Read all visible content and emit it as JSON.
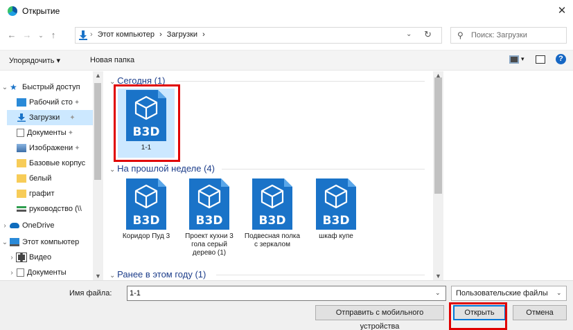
{
  "window": {
    "title": "Открытие",
    "close": "✕"
  },
  "address": {
    "crumbs": [
      "Этот компьютер",
      "›",
      "Загрузки",
      "›"
    ],
    "search_placeholder": "Поиск: Загрузки"
  },
  "toolbar": {
    "organize": "Упорядочить ▾",
    "new_folder": "Новая папка",
    "help": "?"
  },
  "nav": {
    "items": [
      {
        "label": "Быстрый доступ",
        "pinned": false
      },
      {
        "label": "Рабочий сто",
        "pinned": true
      },
      {
        "label": "Загрузки",
        "pinned": true
      },
      {
        "label": "Документы",
        "pinned": true
      },
      {
        "label": "Изображени",
        "pinned": true
      },
      {
        "label": "Базовые корпус",
        "pinned": false
      },
      {
        "label": "белый",
        "pinned": false
      },
      {
        "label": "графит",
        "pinned": false
      },
      {
        "label": "руководство (\\\\",
        "pinned": false
      },
      {
        "label": "OneDrive",
        "pinned": false
      },
      {
        "label": "Этот компьютер",
        "pinned": false
      },
      {
        "label": "Видео",
        "pinned": false
      },
      {
        "label": "Документы",
        "pinned": false
      }
    ]
  },
  "groups": [
    {
      "header": "Сегодня (1)",
      "files": [
        {
          "label": "1-1",
          "badge": "B3D"
        }
      ]
    },
    {
      "header": "На прошлой неделе (4)",
      "files": [
        {
          "label": "Коридор Пуд 3",
          "badge": "B3D"
        },
        {
          "label": "Проект кухни 3 гола серый дерево (1)",
          "badge": "B3D"
        },
        {
          "label": "Подвесная полка с зеркалом",
          "badge": "B3D"
        },
        {
          "label": "шкаф купе",
          "badge": "B3D"
        }
      ]
    },
    {
      "header": "Ранее в этом году (1)",
      "files": []
    }
  ],
  "bottom": {
    "filename_label": "Имя файла:",
    "filename_value": "1-1",
    "filter_value": "Пользовательские файлы",
    "mobile_button": "Отправить с мобильного устройства",
    "open_button": "Открыть",
    "cancel_button": "Отмена"
  },
  "colors": {
    "accent": "#0078d7",
    "file_icon": "#1a73c8",
    "highlight": "#e00000",
    "group_header": "#1c3d8a"
  }
}
